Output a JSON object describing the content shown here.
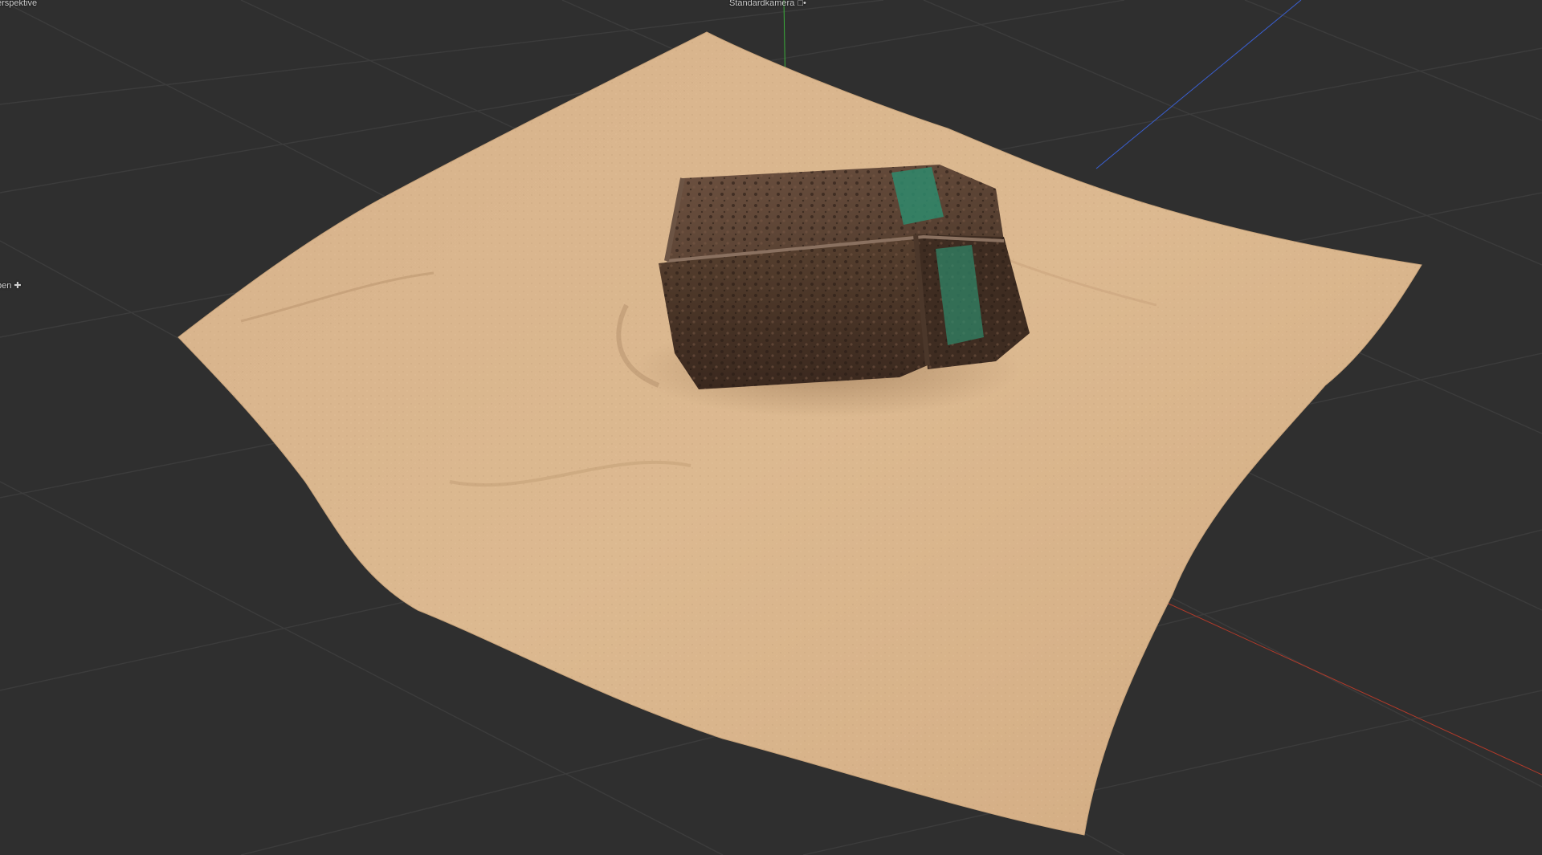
{
  "viewport": {
    "view_name": "erspektive",
    "camera_name": "Standardkamera",
    "camera_icon": "camera-icon",
    "edge_label": "ben",
    "edge_icon": "move-icon",
    "colors": {
      "background": "#2f2f2f",
      "grid_line": "#3c3c3c",
      "axis_x": "#b23a2a",
      "axis_y": "#3bb03b",
      "axis_z": "#3a5fd0",
      "sand": "#d9b48c",
      "sand_dark": "#b58e66",
      "rust": "#4a3528",
      "rust_dark": "#2e2019",
      "patina": "#2f8a6c"
    }
  }
}
